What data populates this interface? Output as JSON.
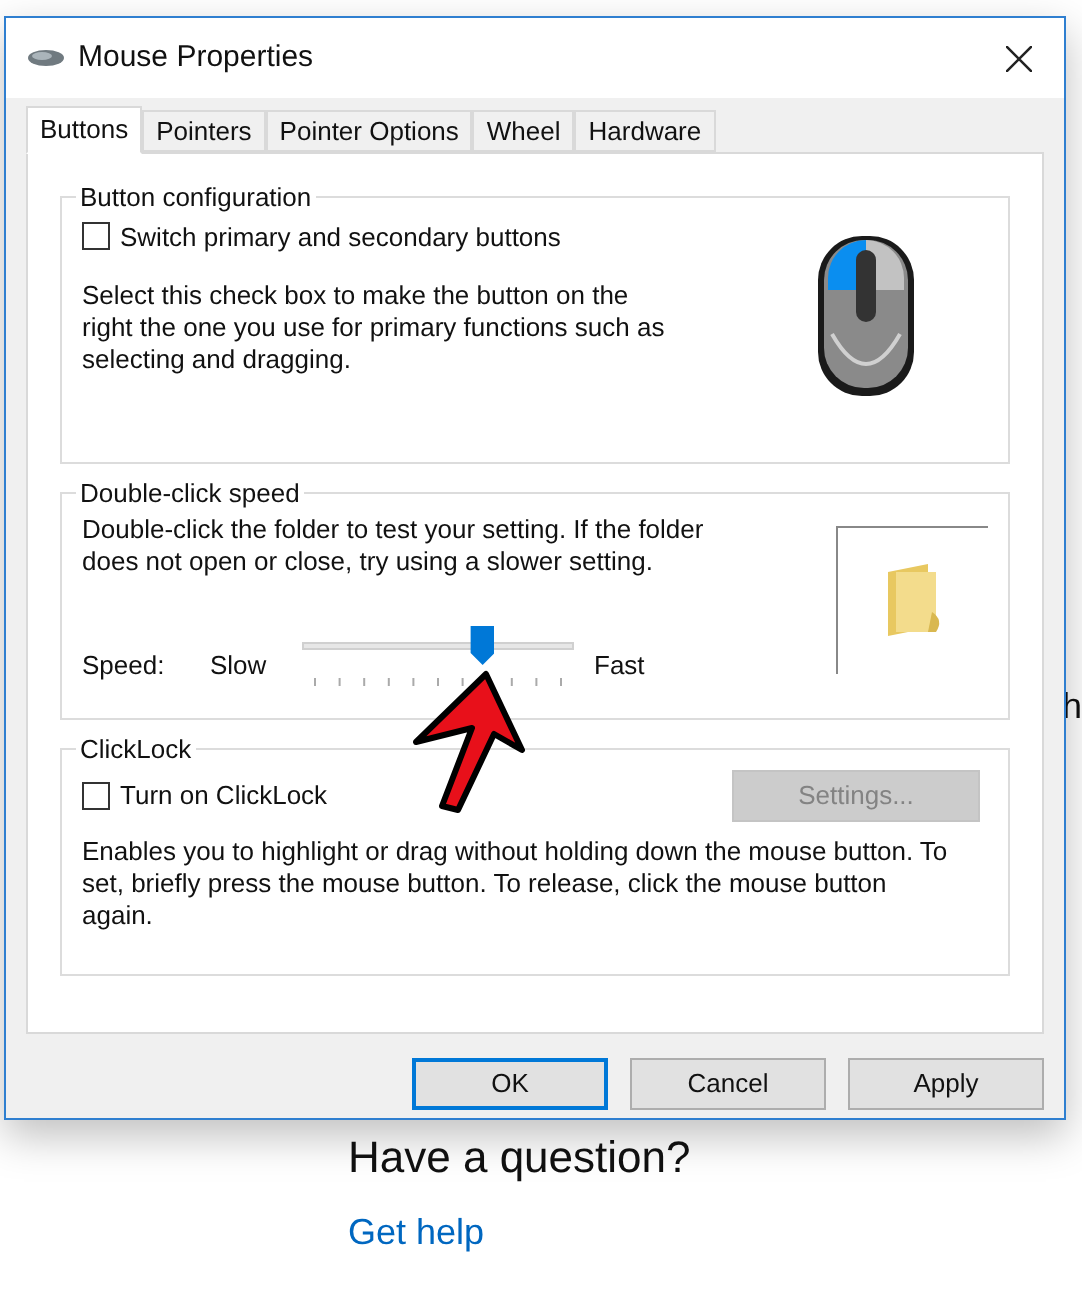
{
  "window": {
    "title": "Mouse Properties"
  },
  "tabs": [
    {
      "label": "Buttons",
      "selected": true
    },
    {
      "label": "Pointers",
      "selected": false
    },
    {
      "label": "Pointer Options",
      "selected": false
    },
    {
      "label": "Wheel",
      "selected": false
    },
    {
      "label": "Hardware",
      "selected": false
    }
  ],
  "button_configuration": {
    "title": "Button configuration",
    "checkbox": {
      "label": "Switch primary and secondary buttons",
      "checked": false
    },
    "description": "Select this check box to make the button on the right the one you use for primary functions such as selecting and dragging."
  },
  "double_click_speed": {
    "title": "Double-click speed",
    "description": "Double-click the folder to test your setting. If the folder does not open or close, try using a slower setting.",
    "speed_label": "Speed:",
    "slow_label": "Slow",
    "fast_label": "Fast",
    "slider": {
      "level": 0.68
    }
  },
  "clicklock": {
    "title": "ClickLock",
    "checkbox": {
      "label": "Turn on ClickLock",
      "checked": false
    },
    "settings_button": {
      "label": "Settings...",
      "disabled": true
    },
    "description": "Enables you to highlight or drag without holding down the mouse button. To set, briefly press the mouse button. To release, click the mouse button again."
  },
  "buttons": [
    {
      "label": "OK",
      "selected": true
    },
    {
      "label": "Cancel",
      "selected": false
    },
    {
      "label": "Apply",
      "selected": false
    }
  ],
  "background": {
    "side_text": "h",
    "heading": "Have a question?",
    "link": "Get help"
  }
}
